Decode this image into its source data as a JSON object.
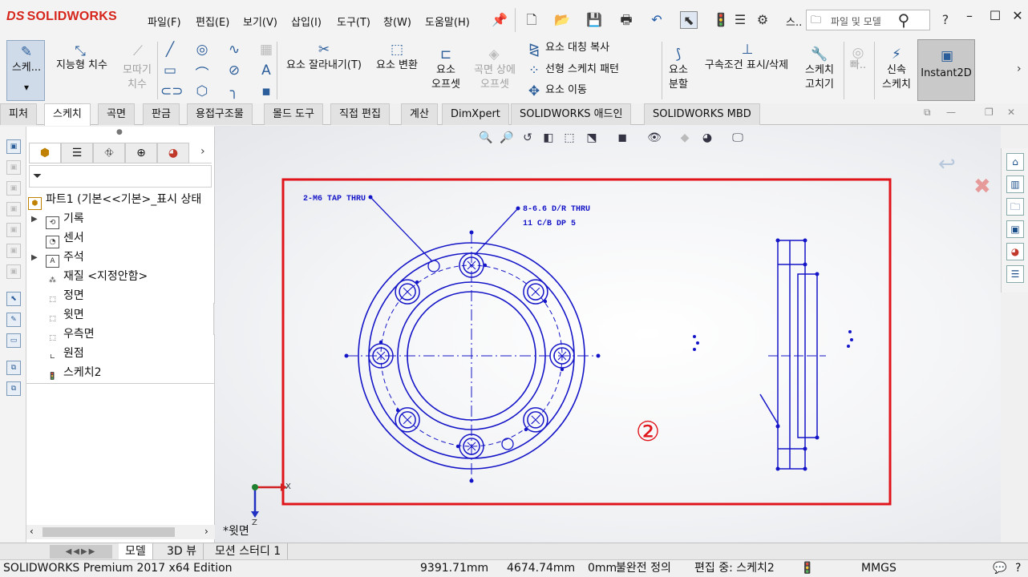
{
  "app": {
    "logo_text": "SOLIDWORKS",
    "logo_mark": "DS",
    "menus": [
      "파일(F)",
      "편집(E)",
      "보기(V)",
      "삽입(I)",
      "도구(T)",
      "창(W)",
      "도움말(H)"
    ],
    "search_placeholder": "파일 및 모델",
    "quick_toolbar_more": "스.."
  },
  "ribbon": {
    "sketch": "스케...",
    "smart_dimension": "지능형 치수",
    "mirror_dim_1": "모따기",
    "mirror_dim_2": "치수",
    "trim": "요소 잘라내기(T)",
    "convert": "요소 변환",
    "offset_1": "요소",
    "offset_2": "오프셋",
    "offset_surface_1": "곡면 상에",
    "offset_surface_2": "오프셋",
    "mirror_entities": "요소 대칭 복사",
    "linear_pattern": "선형 스케치 패턴",
    "move_entities": "요소 이동",
    "split_1": "요소",
    "split_2": "분할",
    "relations": "구속조건 표시/삭제",
    "repair_1": "스케치",
    "repair_2": "고치기",
    "quick_snaps": "빠..",
    "rapid_1": "신속",
    "rapid_2": "스케치",
    "instant2d": "Instant2D"
  },
  "tabs": [
    "피처",
    "스케치",
    "곡면",
    "판금",
    "용접구조물",
    "몰드 도구",
    "직접 편집",
    "계산",
    "DimXpert",
    "SOLIDWORKS 애드인",
    "SOLIDWORKS MBD"
  ],
  "active_tab": "스케치",
  "tree": {
    "root": "파트1 (기본<<기본>_표시 상태",
    "items": [
      "기록",
      "센서",
      "주석",
      "재질 <지정안함>",
      "정면",
      "윗면",
      "우측면",
      "원점",
      "스케치2"
    ]
  },
  "canvas": {
    "note_tap": "2-M6 TAP THRU",
    "note_hole_1": "8-6.6 D/R THRU",
    "note_hole_2": "11 C/B DP 5",
    "marker": "②",
    "view_label": "*윗면",
    "axis_x": "X",
    "axis_z": "Z",
    "highlight_color": "#e0141b",
    "sketch_color": "#1515c8"
  },
  "bottom_tabs": [
    "모델",
    "3D 뷰",
    "모션 스터디 1"
  ],
  "status": {
    "edition": "SOLIDWORKS Premium 2017 x64 Edition",
    "x": "9391.71mm",
    "y": "4674.74mm",
    "z": "0mm",
    "definition": "불완전 정의",
    "editing": "편집 중: 스케치2",
    "units": "MMGS"
  }
}
